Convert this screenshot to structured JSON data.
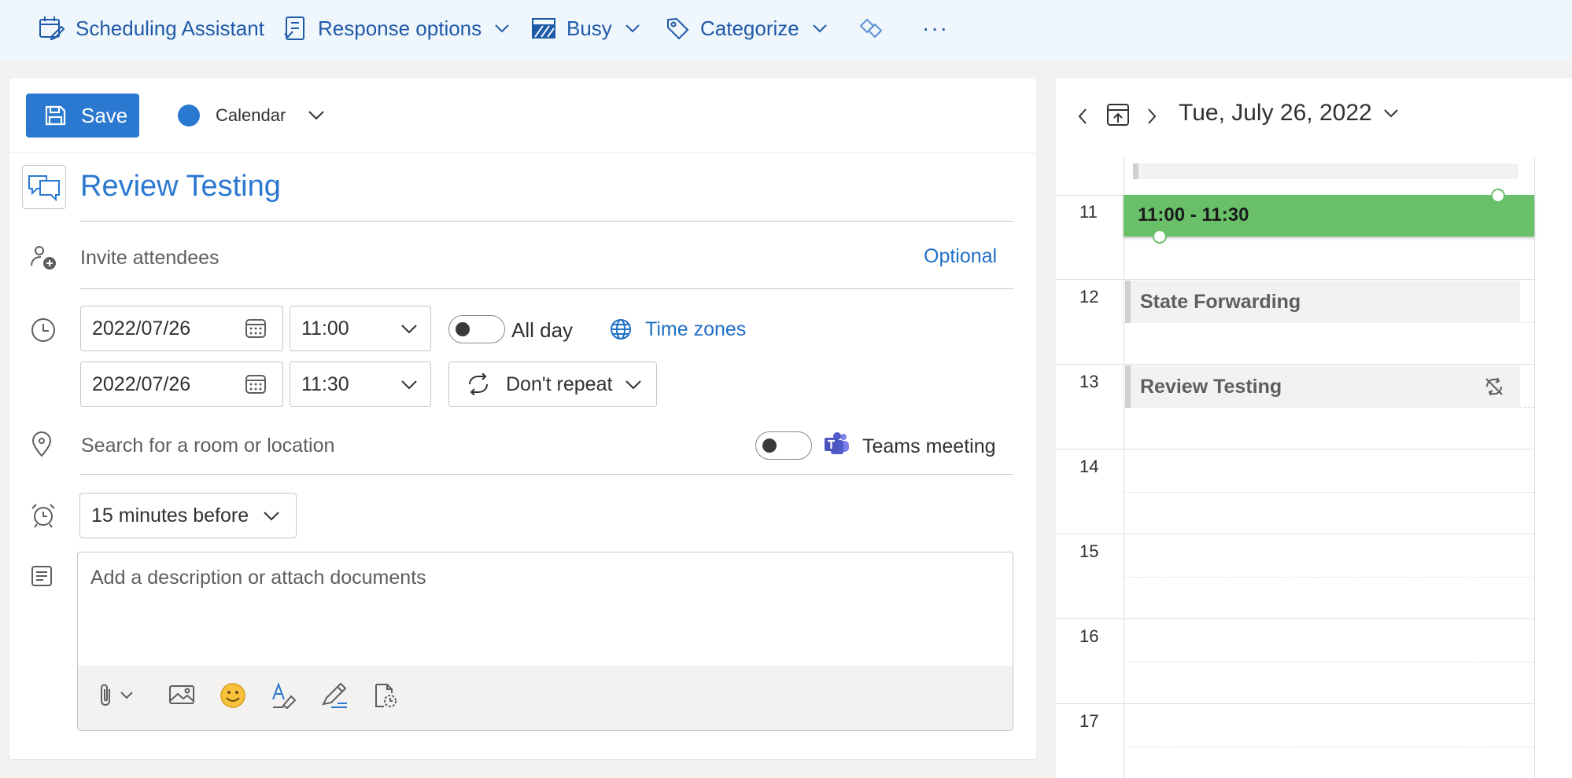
{
  "toolbar": {
    "scheduling_assistant": "Scheduling Assistant",
    "response_options": "Response options",
    "busy": "Busy",
    "categorize": "Categorize",
    "more": "···"
  },
  "form": {
    "save_label": "Save",
    "calendar_label": "Calendar",
    "calendar_color": "#2b78d0",
    "title": "Review Testing",
    "invite_placeholder": "Invite attendees",
    "optional_label": "Optional",
    "start_date": "2022/07/26",
    "start_time": "11:00",
    "end_date": "2022/07/26",
    "end_time": "11:30",
    "all_day_label": "All day",
    "time_zones_label": "Time zones",
    "repeat_label": "Don't repeat",
    "location_placeholder": "Search for a room or location",
    "teams_label": "Teams meeting",
    "reminder_label": "15 minutes before",
    "description_placeholder": "Add a description or attach documents"
  },
  "calendar": {
    "date_label": "Tue, July 26, 2022",
    "hours": [
      "11",
      "12",
      "13",
      "14",
      "15",
      "16",
      "17"
    ],
    "new_event_time": "11:00 - 11:30",
    "new_event_color": "#6abf69",
    "events": [
      "State Forwarding",
      "Review Testing"
    ]
  },
  "colors": {
    "accent": "#2b78d0",
    "toolbar_bg": "#eff6fc",
    "link": "#1f6fc5"
  }
}
